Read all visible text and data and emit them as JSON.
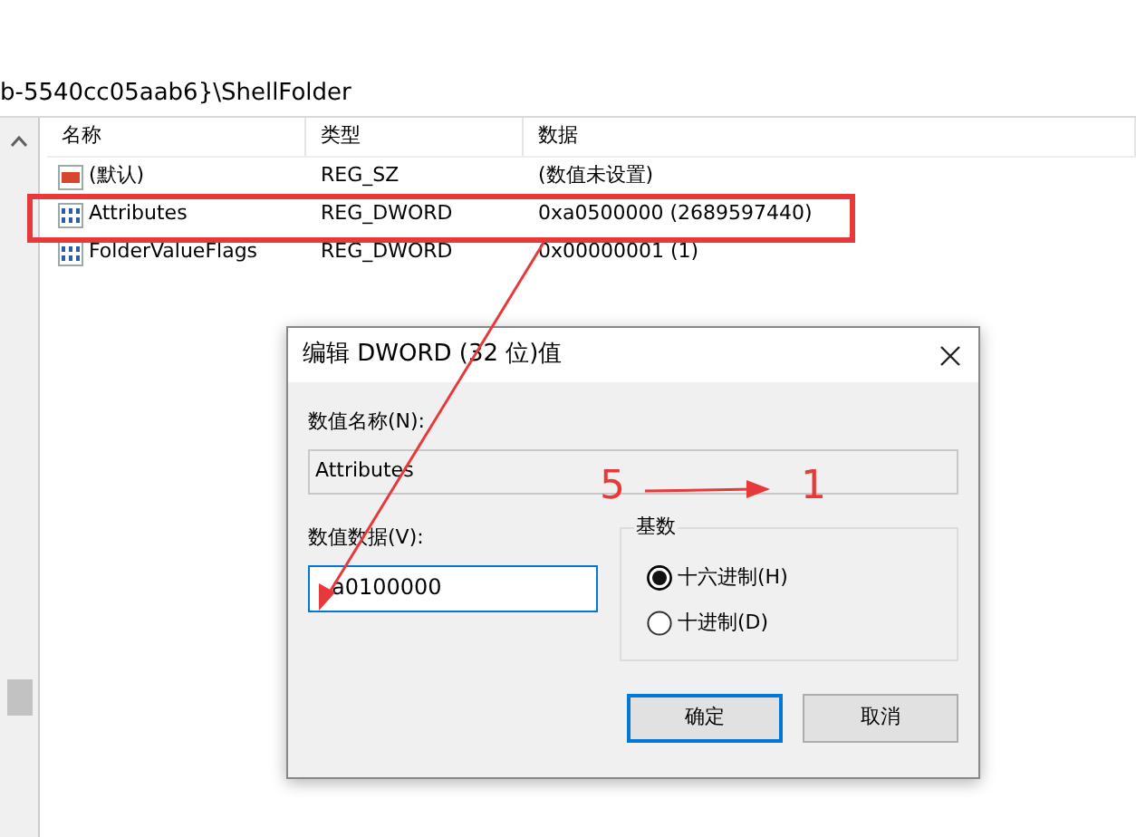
{
  "address": "b-5540cc05aab6}\\ShellFolder",
  "columns": [
    "名称",
    "类型",
    "数据"
  ],
  "rows": [
    {
      "kind": "string",
      "name": "(默认)",
      "type": "REG_SZ",
      "data": "(数值未设置)"
    },
    {
      "kind": "binary",
      "name": "Attributes",
      "type": "REG_DWORD",
      "data": "0xa0500000 (2689597440)"
    },
    {
      "kind": "binary",
      "name": "FolderValueFlags",
      "type": "REG_DWORD",
      "data": "0x00000001 (1)"
    }
  ],
  "dialog": {
    "title": "编辑 DWORD (32 位)值",
    "name_label": "数值名称(N):",
    "name_value": "Attributes",
    "data_label": "数值数据(V):",
    "data_value": "a0100000",
    "base_label": "基数",
    "radios": [
      {
        "label": "十六进制(H)",
        "selected": true
      },
      {
        "label": "十进制(D)",
        "selected": false
      }
    ],
    "buttons": [
      {
        "label": "确定",
        "default": true
      },
      {
        "label": "取消",
        "default": false
      }
    ]
  },
  "annotation": {
    "from": "5",
    "to": "1"
  }
}
